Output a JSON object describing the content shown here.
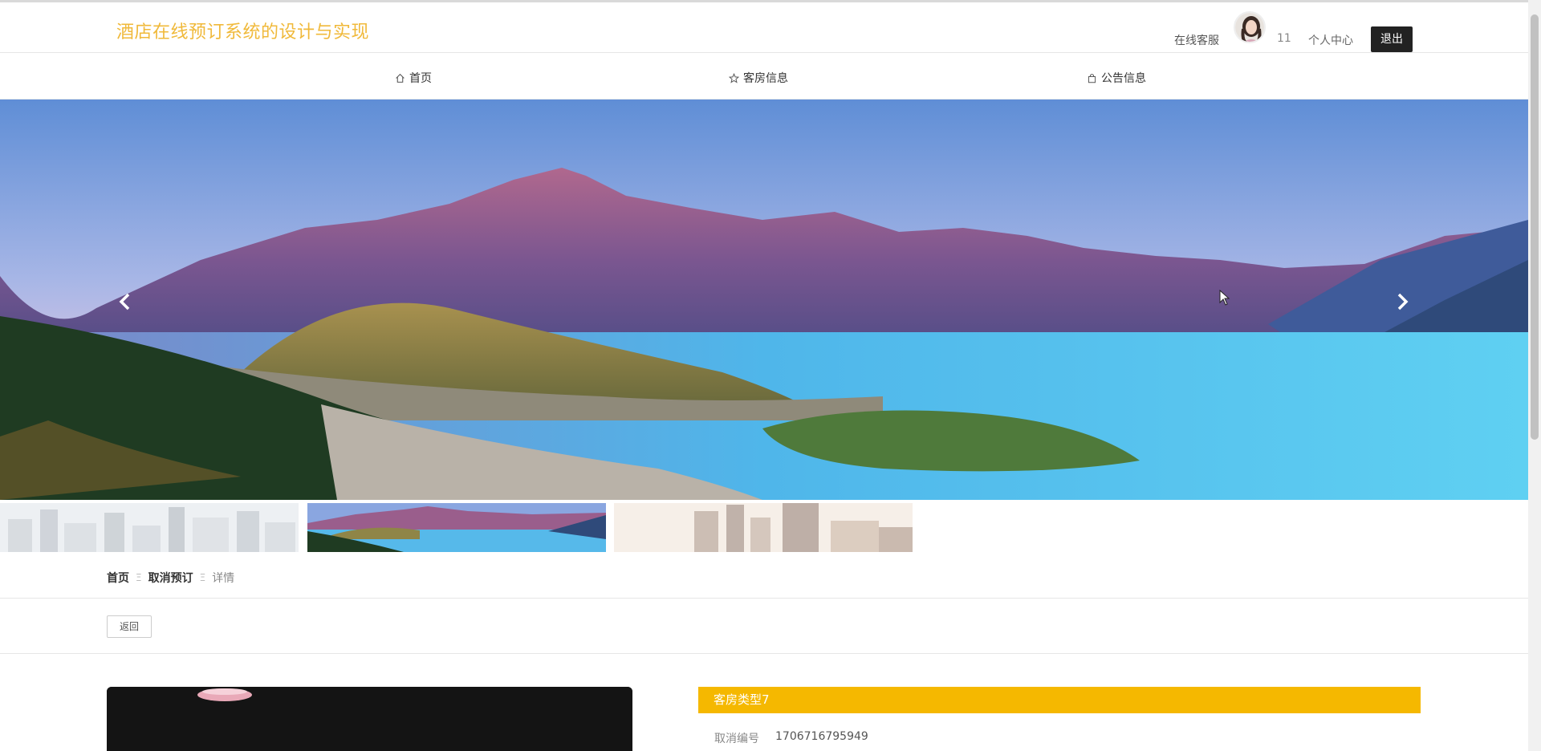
{
  "header": {
    "site_title": "酒店在线预订系统的设计与实现",
    "service_label": "在线客服",
    "username": "11",
    "user_center_label": "个人中心",
    "logout_label": "退出"
  },
  "nav": {
    "items": [
      {
        "label": "首页",
        "icon": "home-icon"
      },
      {
        "label": "客房信息",
        "icon": "star-icon"
      },
      {
        "label": "公告信息",
        "icon": "bag-icon"
      }
    ]
  },
  "carousel": {
    "prev_icon": "chevron-left-icon",
    "next_icon": "chevron-right-icon",
    "active_index": 1,
    "thumbnail_count": 3
  },
  "breadcrumb": {
    "home": "首页",
    "section": "取消预订",
    "current": "详情",
    "separator": "Ξ"
  },
  "actions": {
    "back_label": "返回"
  },
  "detail": {
    "room_type": "客房类型7",
    "cancel_no_label": "取消编号",
    "cancel_no_value": "1706716795949"
  },
  "colors": {
    "brand": "#f0b93a",
    "title_bar": "#f5b800",
    "logout_bg": "#222222"
  }
}
